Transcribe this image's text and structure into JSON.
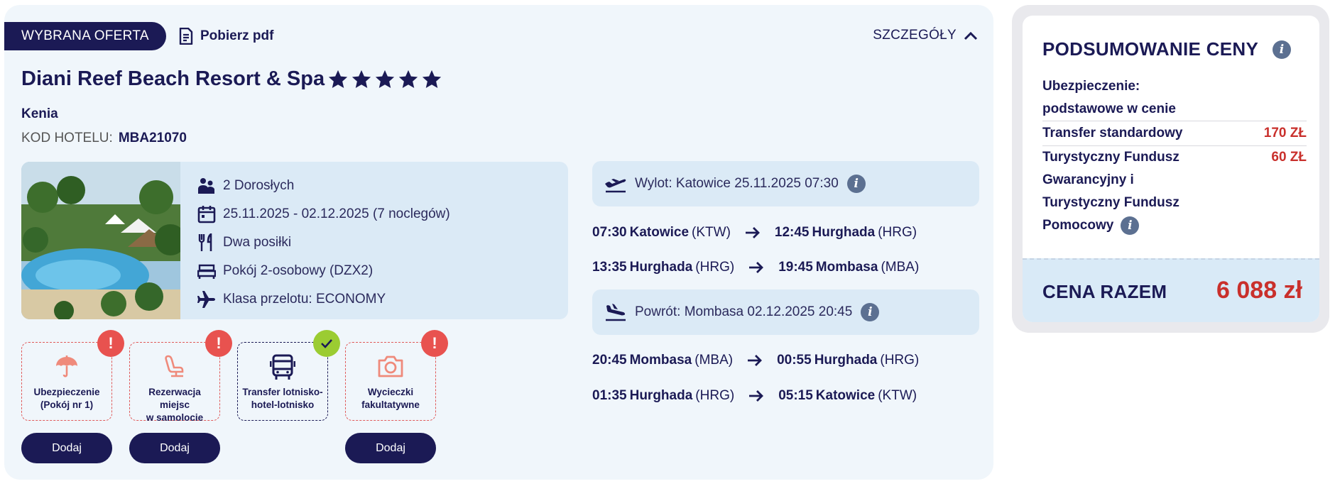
{
  "offer": {
    "tag": "WYBRANA OFERTA",
    "pdf_label": "Pobierz pdf",
    "details_label": "SZCZEGÓŁY",
    "hotel_name": "Diani Reef Beach Resort & Spa",
    "stars": 5,
    "location": "Kenia",
    "hotel_code_label": "KOD HOTELU:",
    "hotel_code": "MBA21070",
    "info": {
      "travelers": "2 Dorosłych",
      "dates": "25.11.2025 - 02.12.2025 (7 noclegów)",
      "board": "Dwa posiłki",
      "room": "Pokój 2-osobowy (DZX2)",
      "flight_class": "Klasa przelotu: ECONOMY"
    },
    "addons": [
      {
        "label_line1": "Ubezpieczenie",
        "label_line2": "(Pokój nr 1)",
        "status": "warning",
        "button": "Dodaj"
      },
      {
        "label_line1": "Rezerwacja miejsc",
        "label_line2": "w samolocie",
        "status": "warning",
        "button": "Dodaj"
      },
      {
        "label_line1": "Transfer lotnisko-",
        "label_line2": "hotel-lotnisko",
        "status": "ok",
        "button": ""
      },
      {
        "label_line1": "Wycieczki",
        "label_line2": "fakultatywne",
        "status": "warning",
        "button": "Dodaj"
      }
    ]
  },
  "flights": {
    "outbound_header": "Wylot: Katowice 25.11.2025 07:30",
    "return_header": "Powrót: Mombasa 02.12.2025 20:45",
    "outbound_legs": [
      {
        "dep_time": "07:30",
        "dep_city": "Katowice",
        "dep_code": "(KTW)",
        "arr_time": "12:45",
        "arr_city": "Hurghada",
        "arr_code": "(HRG)"
      },
      {
        "dep_time": "13:35",
        "dep_city": "Hurghada",
        "dep_code": "(HRG)",
        "arr_time": "19:45",
        "arr_city": "Mombasa",
        "arr_code": "(MBA)"
      }
    ],
    "return_legs": [
      {
        "dep_time": "20:45",
        "dep_city": "Mombasa",
        "dep_code": "(MBA)",
        "arr_time": "00:55",
        "arr_city": "Hurghada",
        "arr_code": "(HRG)"
      },
      {
        "dep_time": "01:35",
        "dep_city": "Hurghada",
        "dep_code": "(HRG)",
        "arr_time": "05:15",
        "arr_city": "Katowice",
        "arr_code": "(KTW)"
      }
    ]
  },
  "summary": {
    "title": "PODSUMOWANIE CENY",
    "insurance_line1": "Ubezpieczenie:",
    "insurance_line2": "podstawowe w cenie",
    "transfer_label": "Transfer standardowy",
    "transfer_price": "170 ZŁ",
    "fund_line1": "Turystyczny Fundusz",
    "fund_line2": "Gwarancyjny i",
    "fund_line3": "Turystyczny Fundusz",
    "fund_line4": "Pomocowy",
    "fund_price": "60 ZŁ",
    "total_label": "CENA RAZEM",
    "total_value": "6 088 zł"
  },
  "colors": {
    "navy": "#1b1a55",
    "price_red": "#c9302c",
    "warning": "#e8524f",
    "success": "#9bcc32",
    "panel": "#f0f6fb"
  }
}
